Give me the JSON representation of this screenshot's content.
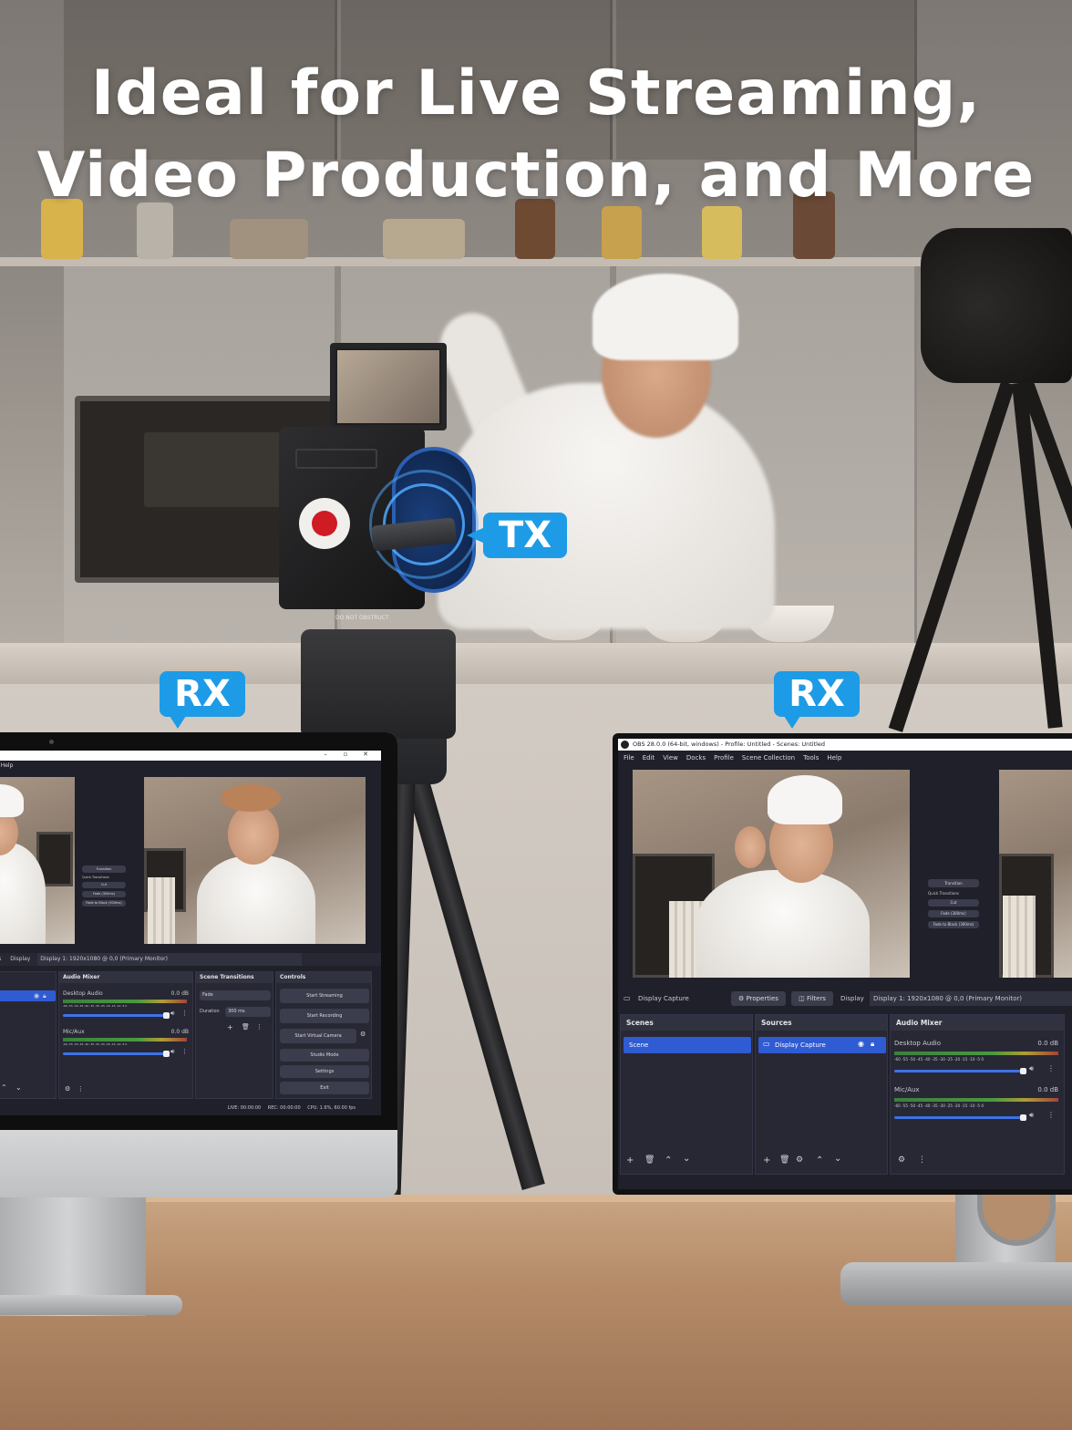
{
  "headline": {
    "line1": "Ideal for Live Streaming,",
    "line2": "Video Production, and More"
  },
  "badges": {
    "tx": "TX",
    "rx_left": "RX",
    "rx_right": "RX",
    "color": "#1d9be6"
  },
  "camera": {
    "tag": "DO NOT OBSTRUCT"
  },
  "obs_right": {
    "title": "OBS 28.0.0 (64-bit, windows) - Profile: Untitled - Scenes: Untitled",
    "menu": [
      "File",
      "Edit",
      "View",
      "Docks",
      "Profile",
      "Scene Collection",
      "Tools",
      "Help"
    ],
    "source_label": "Display Capture",
    "properties_label": "Properties",
    "filters_label": "Filters",
    "display_label": "Display",
    "display_value": "Display 1: 1920x1080 @ 0,0 (Primary Monitor)",
    "scenes_header": "Scenes",
    "scene_item": "Scene",
    "sources_header": "Sources",
    "source_item": "Display Capture",
    "mixer_header": "Audio Mixer",
    "track1_name": "Desktop Audio",
    "track1_db": "0.0 dB",
    "track2_name": "Mic/Aux",
    "track2_db": "0.0 dB",
    "meter_ticks": "-60 -55 -50 -45 -40 -35 -30 -25 -20 -15 -10 -5 0",
    "transitions": [
      "Transition",
      "Quick Transitions",
      "Cut",
      "Fade (300ms)",
      "Fade to Black (300ms)"
    ]
  },
  "obs_left": {
    "menu_fragment": "ls  Help",
    "window_controls": [
      "–",
      "▫",
      "✕"
    ],
    "display_prefix": "ers",
    "display_label": "Display",
    "display_value": "Display 1: 1920x1080 @ 0,0 (Primary Monitor)",
    "mixer_header": "Audio Mixer",
    "track1_name": "Desktop Audio",
    "track1_db": "0.0 dB",
    "track2_name": "Mic/Aux",
    "track2_db": "0.0 dB",
    "meter_ticks": "-60 -55 -50 -45 -40 -35 -30 -25 -20 -15 -10 -5 0",
    "transitions_header": "Scene Transitions",
    "transition_value": "Fade",
    "duration_label": "Duration",
    "duration_value": "300 ms",
    "controls_header": "Controls",
    "controls": [
      "Start Streaming",
      "Start Recording",
      "Start Virtual Camera",
      "Studio Mode",
      "Settings",
      "Exit"
    ],
    "status": "LIVE: 00:00:00",
    "rec": "REC: 00:00:00",
    "cpu": "CPU: 1.6%, 60.00 fps",
    "scene_row_fragment": "re",
    "mini_transitions": [
      "Transition",
      "Quick Transitions",
      "Cut",
      "Fade (300ms)",
      "Fade to Black (300ms)"
    ]
  }
}
